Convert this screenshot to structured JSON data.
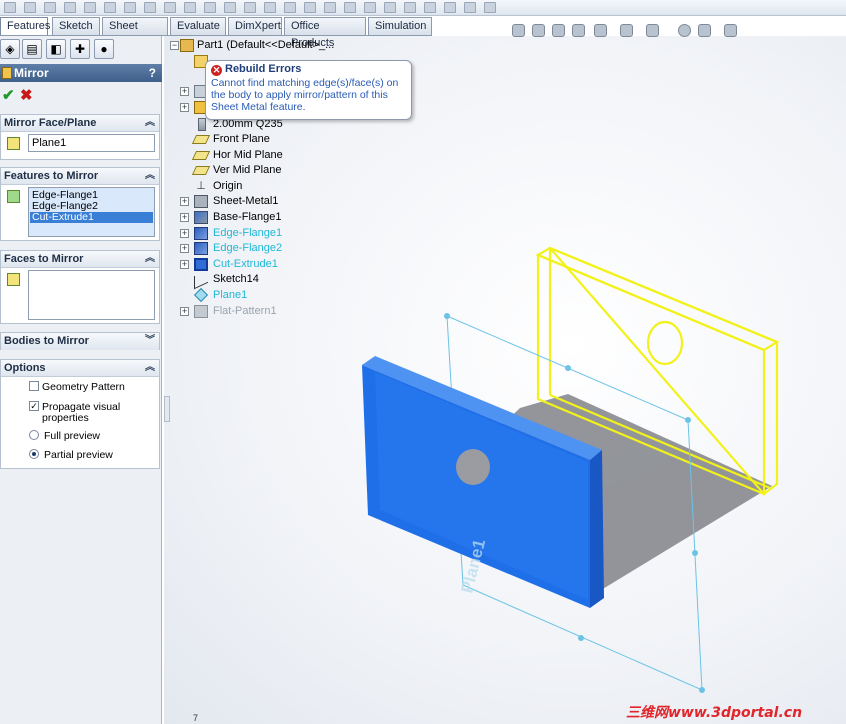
{
  "top_tabs": [
    {
      "label": "Features",
      "active": true
    },
    {
      "label": "Sketch",
      "active": false
    },
    {
      "label": "Sheet Metal",
      "active": false
    },
    {
      "label": "Evaluate",
      "active": false
    },
    {
      "label": "DimXpert",
      "active": false
    },
    {
      "label": "Office Products",
      "active": false
    },
    {
      "label": "Simulation",
      "active": false
    }
  ],
  "property_manager": {
    "title": "Mirror",
    "help": "?",
    "ok_icon": "check-icon",
    "cancel_icon": "cross-icon",
    "mirror_face": {
      "header": "Mirror Face/Plane",
      "value": "Plane1"
    },
    "features": {
      "header": "Features to Mirror",
      "items": [
        "Edge-Flange1",
        "Edge-Flange2",
        "Cut-Extrude1"
      ],
      "selected_index": 2
    },
    "faces": {
      "header": "Faces to Mirror"
    },
    "bodies": {
      "header": "Bodies to Mirror"
    },
    "options": {
      "header": "Options",
      "geometry_pattern": {
        "label": "Geometry Pattern",
        "checked": false
      },
      "propagate": {
        "label_line1": "Propagate visual",
        "label_line2": "properties",
        "checked": true
      },
      "full_preview": {
        "label": "Full preview",
        "selected": false
      },
      "partial_preview": {
        "label": "Partial preview",
        "selected": true
      }
    }
  },
  "tree": {
    "root": "Part1  (Default<<Default>_...",
    "items": [
      {
        "label": "2.00mm Q235",
        "icon": "cut-list-icon",
        "style": "normal"
      },
      {
        "label": "Front Plane",
        "icon": "plane-icon",
        "style": "normal"
      },
      {
        "label": "Hor Mid Plane",
        "icon": "plane-icon",
        "style": "normal"
      },
      {
        "label": "Ver Mid Plane",
        "icon": "plane-icon",
        "style": "normal"
      },
      {
        "label": "Origin",
        "icon": "origin-icon",
        "style": "normal"
      },
      {
        "label": "Sheet-Metal1",
        "icon": "sheet-metal-icon",
        "style": "normal"
      },
      {
        "label": "Base-Flange1",
        "icon": "base-flange-icon",
        "style": "normal"
      },
      {
        "label": "Edge-Flange1",
        "icon": "edge-flange-icon",
        "style": "cyan"
      },
      {
        "label": "Edge-Flange2",
        "icon": "edge-flange-icon",
        "style": "cyan"
      },
      {
        "label": "Cut-Extrude1",
        "icon": "cut-extrude-icon",
        "style": "cyan"
      },
      {
        "label": "Sketch14",
        "icon": "sketch-icon",
        "style": "normal"
      },
      {
        "label": "Plane1",
        "icon": "plane-icon",
        "style": "cyan"
      },
      {
        "label": "Flat-Pattern1",
        "icon": "flat-pattern-icon",
        "style": "gray"
      }
    ]
  },
  "callout": {
    "title": "Rebuild Errors",
    "message": "Cannot find matching edge(s)/face(s) on the body to apply mirror/pattern of this Sheet Metal feature."
  },
  "viewport": {
    "plane_label": "Plane1",
    "watermark": "三维网www.3dportal.cn",
    "page_indicator": "7"
  },
  "colors": {
    "flange_blue": "#1f6fe8",
    "preview_yellow": "#f2f21a",
    "plane_line": "#6cc3e6",
    "cyan_text": "#1fb8d6"
  }
}
